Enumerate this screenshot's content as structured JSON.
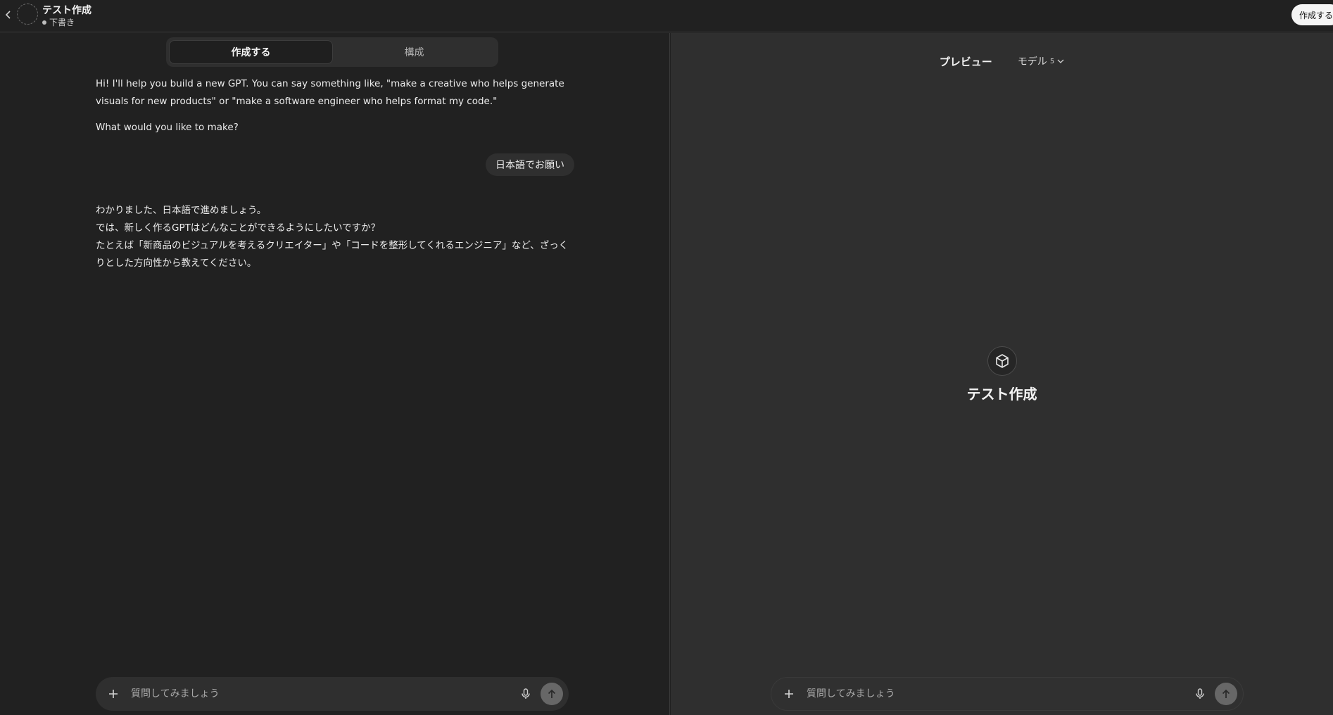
{
  "header": {
    "title": "テスト作成",
    "status": "下書き",
    "create_button": "作成する"
  },
  "left": {
    "tabs": [
      {
        "label": "作成する",
        "active": true
      },
      {
        "label": "構成",
        "active": false
      }
    ],
    "messages": {
      "assistant_intro": "Hi! I'll help you build a new GPT. You can say something like, \"make a creative who helps generate visuals for new products\" or \"make a software engineer who helps format my code.\"",
      "assistant_question": "What would you like to make?",
      "user_reply": "日本語でお願い",
      "assistant_line1": "わかりました、日本語で進めましょう。",
      "assistant_line2": "では、新しく作るGPTはどんなことができるようにしたいですか？",
      "assistant_line3": "たとえば「新商品のビジュアルを考えるクリエイター」や「コードを整形してくれるエンジニア」など、ざっくりとした方向性から教えてください。"
    },
    "composer": {
      "placeholder": "質問してみましょう"
    }
  },
  "right": {
    "preview_label": "プレビュー",
    "model_label": "モデル",
    "model_version": "5",
    "gpt_name": "テスト作成",
    "composer": {
      "placeholder": "質問してみましょう"
    }
  },
  "icons": {
    "back": "chevron-left-icon",
    "avatar": "dashed-circle-icon",
    "plus": "plus-icon",
    "mic": "microphone-icon",
    "send": "arrow-up-icon",
    "chevron": "chevron-down-icon",
    "cube": "cube-icon"
  }
}
